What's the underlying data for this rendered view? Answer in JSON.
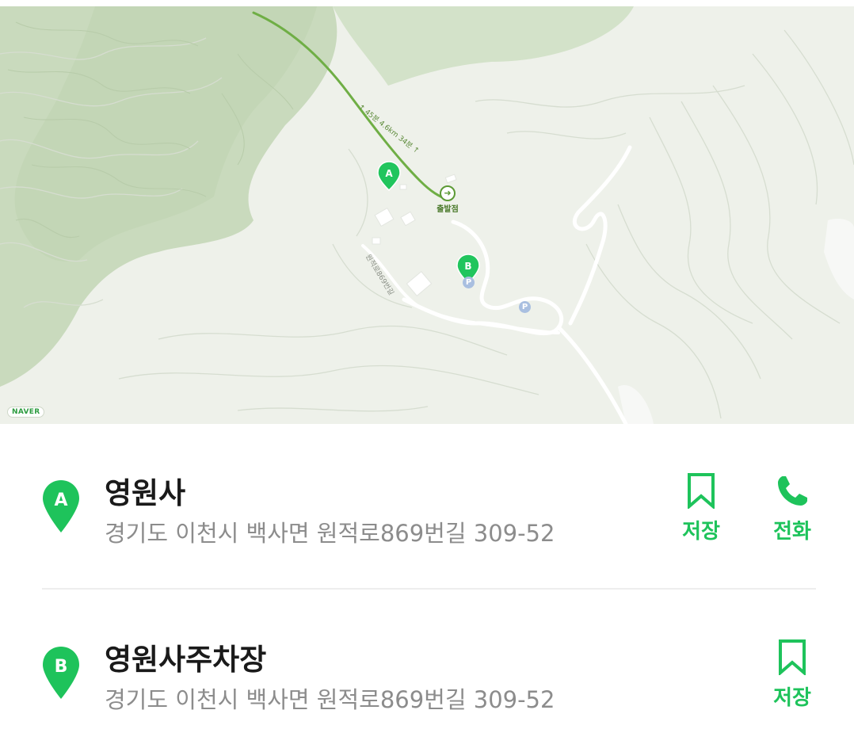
{
  "map": {
    "marker_a_letter": "A",
    "marker_b_letter": "B",
    "start_label": "출발점",
    "start_icon": "arrow-right-icon",
    "parking_letter": "P",
    "road_label": "원적로869번길",
    "route_label": "↑ 45분 4.6km 34분 ↑",
    "logo": "NAVER",
    "colors": {
      "route": "#6fae45",
      "marker": "#21c55d",
      "terrain_dark": "#c8d9bd",
      "terrain_light": "#eef1ea"
    }
  },
  "results": [
    {
      "letter": "A",
      "title": "영원사",
      "address": "경기도 이천시 백사면 원적로869번길 309-52",
      "save_label": "저장",
      "save_icon": "bookmark-icon",
      "call_label": "전화",
      "call_icon": "phone-icon"
    },
    {
      "letter": "B",
      "title": "영원사주차장",
      "address": "경기도 이천시 백사면 원적로869번길 309-52",
      "save_label": "저장",
      "save_icon": "bookmark-icon"
    }
  ],
  "accent_color": "#1ec35b"
}
